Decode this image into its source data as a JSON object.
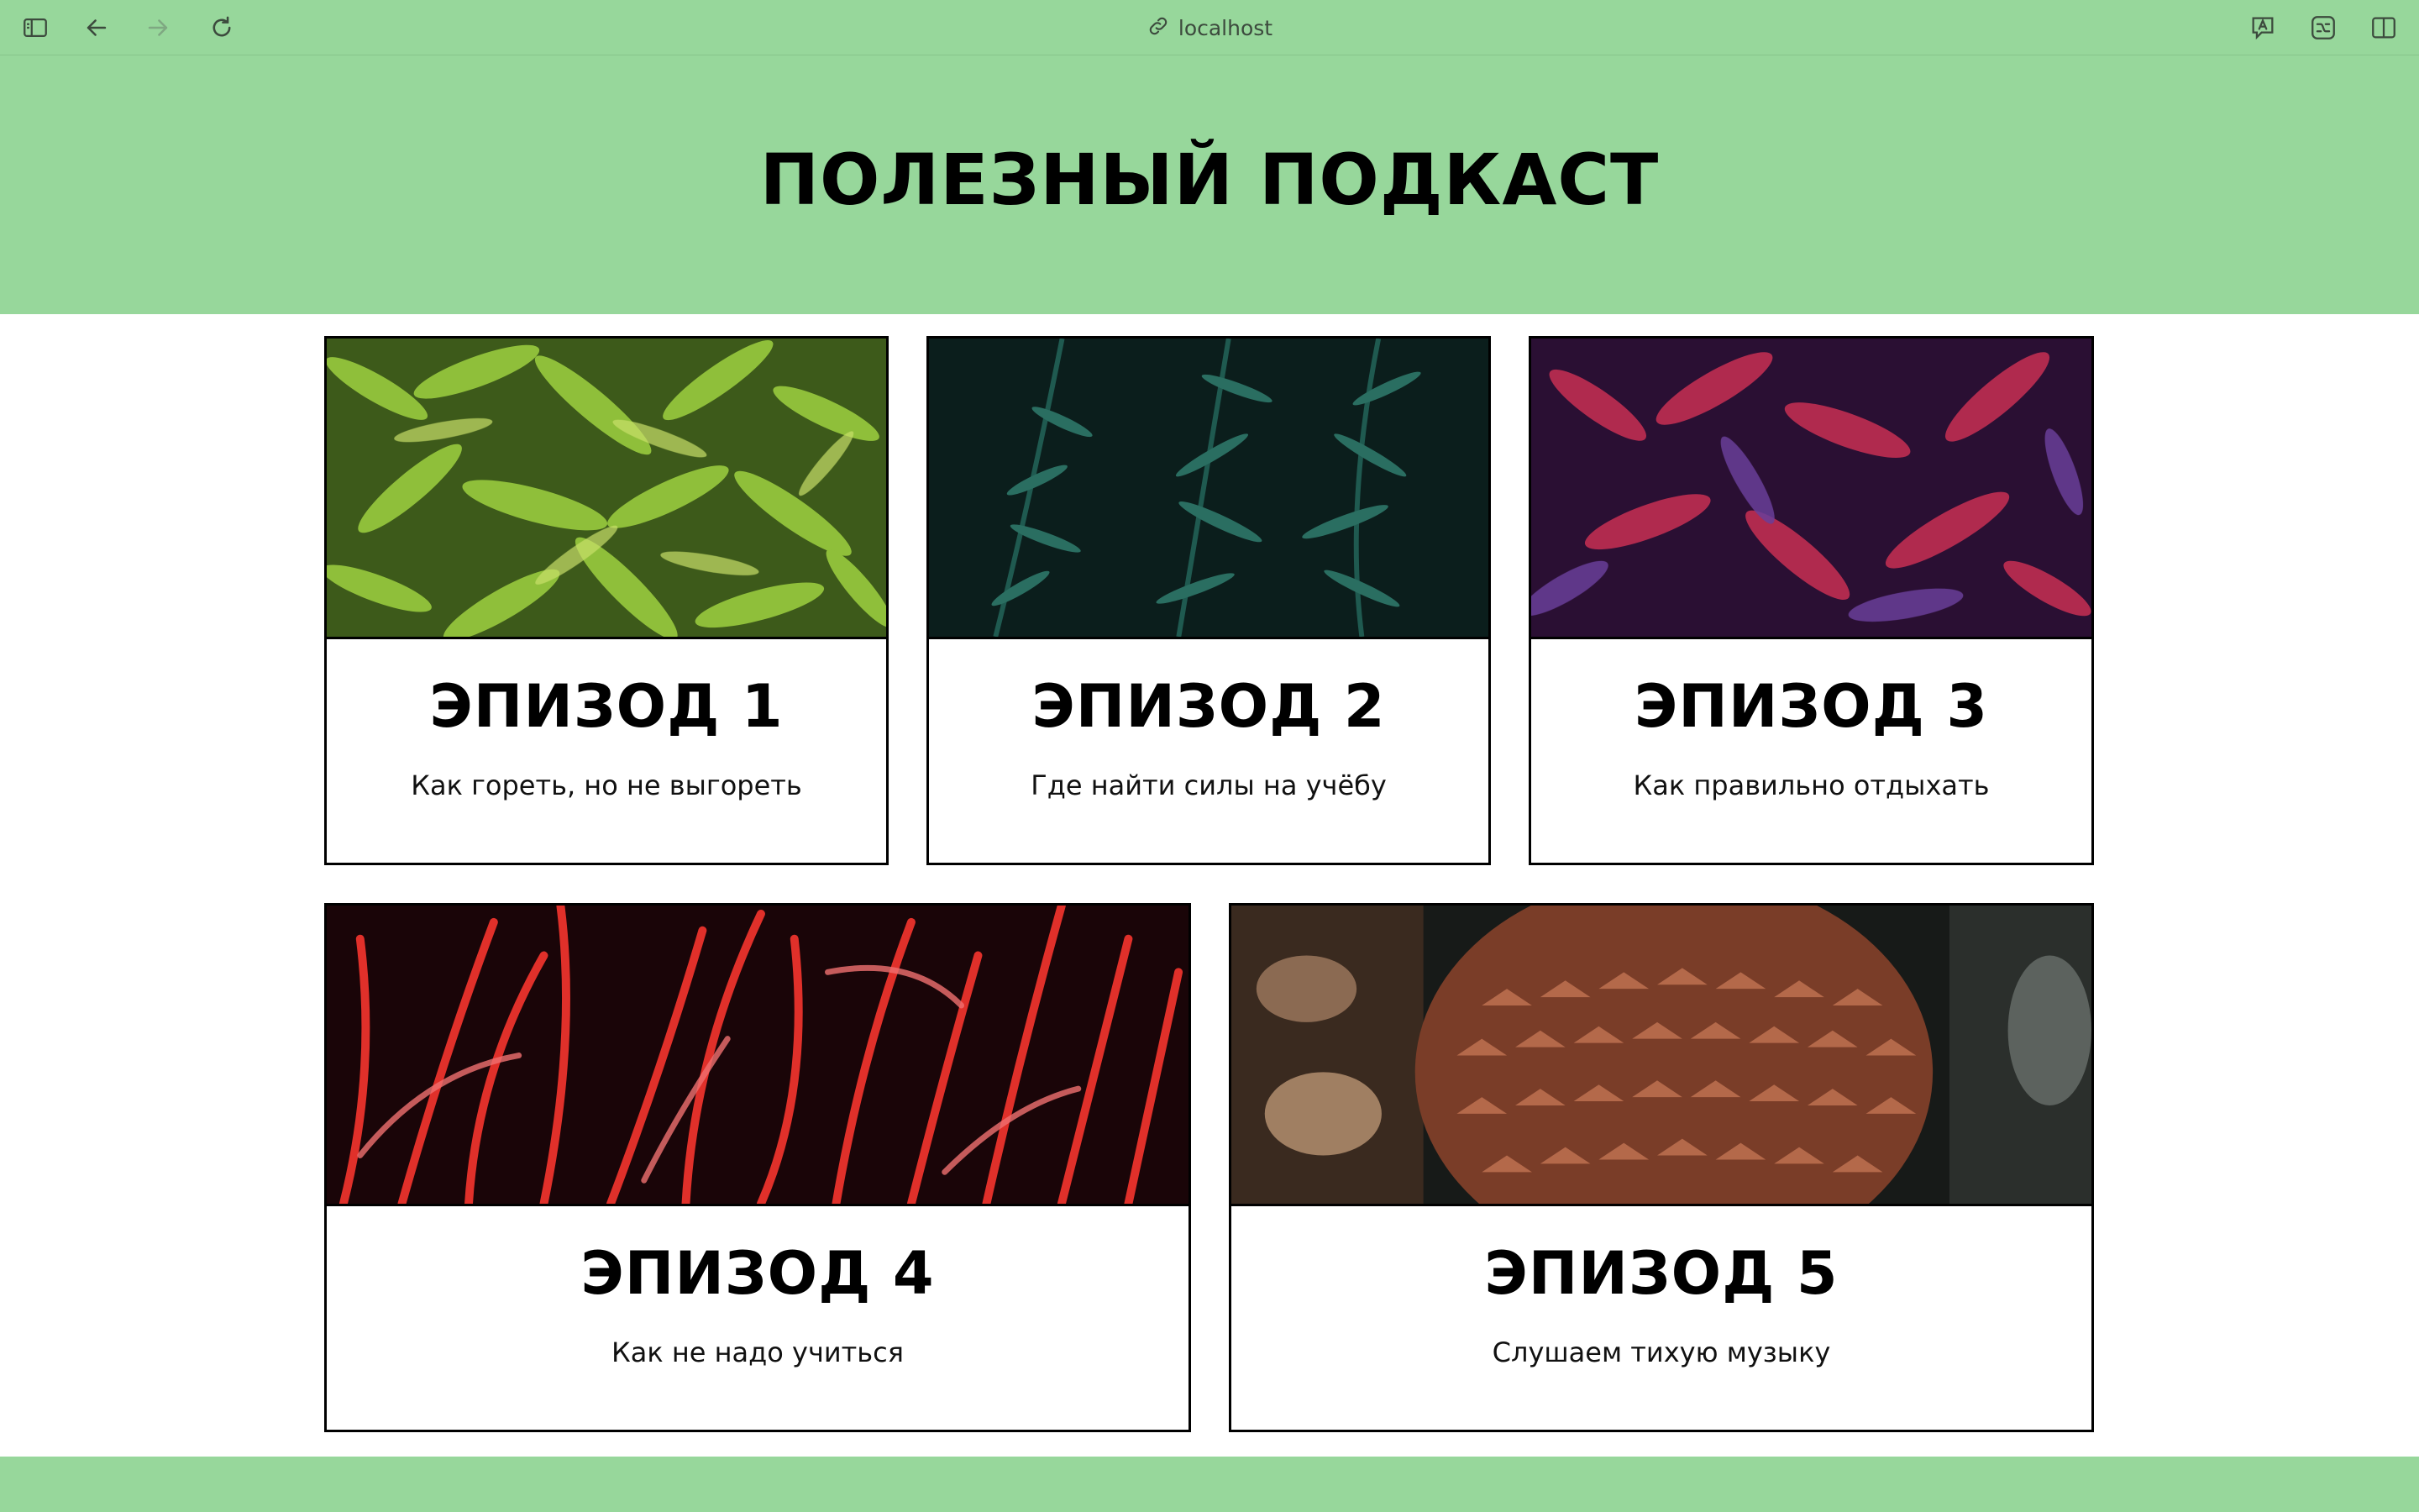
{
  "browser": {
    "url": "localhost",
    "icons": [
      "sidebar-toggle-icon",
      "back-arrow-icon",
      "forward-arrow-icon",
      "reload-icon",
      "link-icon",
      "translate-icon",
      "reader-icon",
      "split-view-icon"
    ]
  },
  "header": {
    "title": "ПОЛЕЗНЫЙ ПОДКАСТ",
    "background": "#97d79b"
  },
  "episodes": [
    {
      "title": "ЭПИЗОД 1",
      "description": "Как гореть, но не выгореть",
      "image": "green-bamboo-leaves"
    },
    {
      "title": "ЭПИЗОД 2",
      "description": "Где найти силы на учёбу",
      "image": "dark-green-fern"
    },
    {
      "title": "ЭПИЗОД 3",
      "description": "Как правильно отдыхать",
      "image": "purple-red-leaves"
    },
    {
      "title": "ЭПИЗОД 4",
      "description": "Как не надо учиться",
      "image": "red-grass"
    },
    {
      "title": "ЭПИЗОД 5",
      "description": "Слушаем тихую музыку",
      "image": "brown-pinecone"
    }
  ]
}
